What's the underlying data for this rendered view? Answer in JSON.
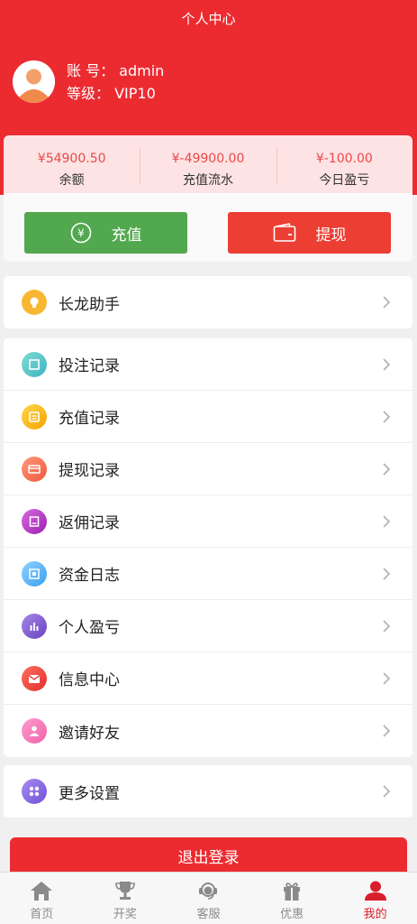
{
  "header": {
    "title": "个人中心"
  },
  "user": {
    "account_text": "账 号： admin",
    "level_text": "等级： VIP10"
  },
  "stats": [
    {
      "value": "¥54900.50",
      "label": "余额"
    },
    {
      "value": "¥-49900.00",
      "label": "充值流水"
    },
    {
      "value": "¥-100.00",
      "label": "今日盈亏"
    }
  ],
  "actions": {
    "recharge_label": "充值",
    "withdraw_label": "提现",
    "recharge_symbol": "¥"
  },
  "menu": {
    "helper": "长龙助手",
    "items": [
      "投注记录",
      "充值记录",
      "提现记录",
      "返佣记录",
      "资金日志",
      "个人盈亏",
      "信息中心",
      "邀请好友"
    ],
    "settings": "更多设置"
  },
  "logout_label": "退出登录",
  "tabbar": [
    "首页",
    "开奖",
    "客服",
    "优惠",
    "我的"
  ],
  "colors": {
    "brand": "#ec2b31",
    "recharge": "#52a84f",
    "withdraw": "#ec3e33",
    "tab_active": "#d91e2b"
  }
}
